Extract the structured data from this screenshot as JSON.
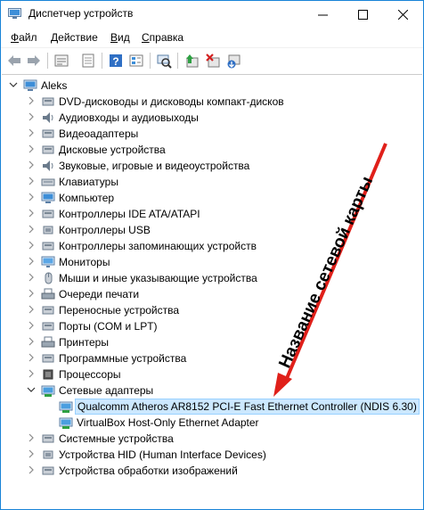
{
  "window": {
    "title": "Диспетчер устройств",
    "accent_color": "#1883d7"
  },
  "menu": {
    "file": {
      "key": "Ф",
      "rest": "айл"
    },
    "action": {
      "key": "Д",
      "rest": "ействие"
    },
    "view": {
      "key": "В",
      "rest": "ид"
    },
    "help": {
      "key": "С",
      "rest": "правка"
    }
  },
  "tree": {
    "root": "Aleks",
    "categories": [
      {
        "label": "DVD-дисководы и дисководы компакт-дисков",
        "icon": "dvd-drive-icon"
      },
      {
        "label": "Аудиовходы и аудиовыходы",
        "icon": "speaker-icon"
      },
      {
        "label": "Видеоадаптеры",
        "icon": "display-adapter-icon"
      },
      {
        "label": "Дисковые устройства",
        "icon": "disk-drive-icon"
      },
      {
        "label": "Звуковые, игровые и видеоустройства",
        "icon": "sound-icon"
      },
      {
        "label": "Клавиатуры",
        "icon": "keyboard-icon"
      },
      {
        "label": "Компьютер",
        "icon": "computer-icon"
      },
      {
        "label": "Контроллеры IDE ATA/ATAPI",
        "icon": "ide-controller-icon"
      },
      {
        "label": "Контроллеры USB",
        "icon": "usb-icon"
      },
      {
        "label": "Контроллеры запоминающих устройств",
        "icon": "storage-controller-icon"
      },
      {
        "label": "Мониторы",
        "icon": "monitor-icon"
      },
      {
        "label": "Мыши и иные указывающие устройства",
        "icon": "mouse-icon"
      },
      {
        "label": "Очереди печати",
        "icon": "print-queue-icon"
      },
      {
        "label": "Переносные устройства",
        "icon": "portable-device-icon"
      },
      {
        "label": "Порты (COM и LPT)",
        "icon": "port-icon"
      },
      {
        "label": "Принтеры",
        "icon": "printer-icon"
      },
      {
        "label": "Программные устройства",
        "icon": "software-device-icon"
      },
      {
        "label": "Процессоры",
        "icon": "processor-icon"
      },
      {
        "label": "Сетевые адаптеры",
        "icon": "network-adapter-icon",
        "expanded": true
      }
    ],
    "network_children": [
      {
        "label": "Qualcomm Atheros AR8152 PCI-E Fast Ethernet Controller (NDIS 6.30)",
        "selected": true
      },
      {
        "label": "VirtualBox Host-Only Ethernet Adapter",
        "selected": false
      }
    ],
    "after": [
      {
        "label": "Системные устройства",
        "icon": "system-device-icon"
      },
      {
        "label": "Устройства HID (Human Interface Devices)",
        "icon": "hid-icon"
      },
      {
        "label": "Устройства обработки изображений",
        "icon": "imaging-device-icon"
      }
    ]
  },
  "annotation": {
    "text": "Название сетевой карты",
    "arrow_color": "#e0201a"
  }
}
